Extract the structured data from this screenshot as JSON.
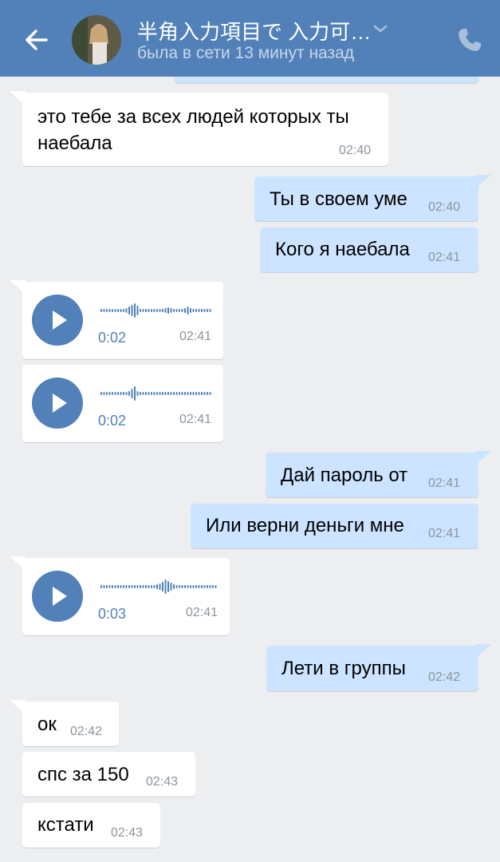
{
  "header": {
    "title": "半角入力項目で 入力可…",
    "status": "была в сети 13 минут назад"
  },
  "messages": [
    {
      "text_line1": "это тебе за всех людей которых ты",
      "text_line2": "наебала",
      "time": "02:40"
    },
    {
      "text": "Ты в своем уме",
      "time": "02:40"
    },
    {
      "text": "Кого я наебала",
      "time": "02:41"
    },
    {
      "duration": "0:02",
      "time": "02:41"
    },
    {
      "duration": "0:02",
      "time": "02:41"
    },
    {
      "text": "Дай пароль от",
      "time": "02:41"
    },
    {
      "text": "Или верни деньги мне",
      "time": "02:41"
    },
    {
      "duration": "0:03",
      "time": "02:41"
    },
    {
      "text": "Лети в группы",
      "time": "02:42"
    },
    {
      "text": "ок",
      "time": "02:42"
    },
    {
      "text": "спс за 150",
      "time": "02:43"
    },
    {
      "text": "кстати",
      "time": "02:43"
    }
  ],
  "colors": {
    "header": "#5181b8",
    "background": "#edeef0",
    "outgoing": "#cce4ff",
    "incoming": "#ffffff",
    "accent": "#5181b8"
  }
}
